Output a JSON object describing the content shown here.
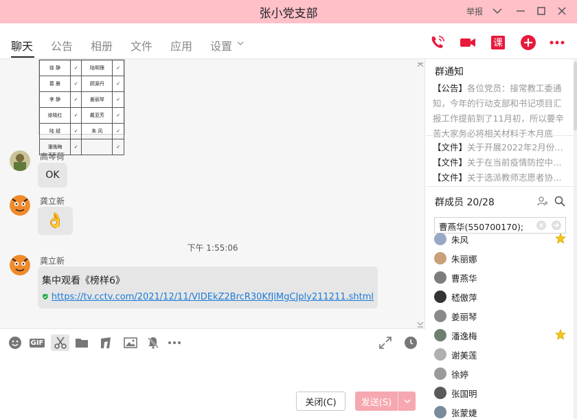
{
  "window": {
    "title": "张小党支部",
    "report_label": "举报"
  },
  "tabs": [
    "聊天",
    "公告",
    "相册",
    "文件",
    "应用",
    "设置"
  ],
  "header_actions": {
    "course_label": "课"
  },
  "table_image": {
    "rows": [
      [
        "徐 静",
        "✓",
        "陆明理",
        "✓"
      ],
      [
        "葛 晨",
        "✓",
        "顾源丹",
        "✓"
      ],
      [
        "李 静",
        "✓",
        "姜丽琴",
        "✓"
      ],
      [
        "徐晓红",
        "✓",
        "戴亚芳",
        "✓"
      ],
      [
        "陆 斌",
        "✓",
        "朱 风",
        "✓"
      ],
      [
        "潘逸梅",
        "✓",
        "",
        "✓"
      ]
    ]
  },
  "messages": [
    {
      "sender": "高琴荷",
      "text": "OK"
    },
    {
      "sender": "龚立新",
      "emoji": "👌"
    },
    {
      "time": "下午 1:55:06"
    },
    {
      "sender": "龚立新",
      "text": "集中观看《榜样6》",
      "link": "https://tv.cctv.com/2021/12/11/VIDEkZ2BrcR30KfJlMgCJply211211.shtml"
    }
  ],
  "toolbar": {
    "gif_label": "GIF"
  },
  "buttons": {
    "close": "关闭(C)",
    "send": "发送(S)"
  },
  "right_panel": {
    "notice_title": "群通知",
    "notice_tag": "【公告】",
    "notice_text": "各位党员：接常教工委通知，今年的行动支部和书记项目汇报工作提前到了11月初，所以要辛苦大家务必将相关材料于本月底（...",
    "files": [
      {
        "tag": "【文件】",
        "text": "关于开展2022年2月份主..."
      },
      {
        "tag": "【文件】",
        "text": "关于在当前疫情防控中进..."
      },
      {
        "tag": "【文件】",
        "text": "关于选派教师志愿者协助..."
      }
    ],
    "members_title": "群成员 20/28",
    "search_value": "曹燕华(550700170);",
    "members": [
      {
        "name": "朱风",
        "star": true
      },
      {
        "name": "朱丽娜",
        "star": false
      },
      {
        "name": "曹燕华",
        "star": false
      },
      {
        "name": "嵇傲萍",
        "star": false
      },
      {
        "name": "姜丽琴",
        "star": false
      },
      {
        "name": "潘逸梅",
        "star": true
      },
      {
        "name": "谢美莲",
        "star": false
      },
      {
        "name": "徐婷",
        "star": false
      },
      {
        "name": "张国明",
        "star": false
      },
      {
        "name": "张蒙婕",
        "star": false
      }
    ]
  },
  "colors": {
    "titlebar": "#ffc0c8",
    "accent": "#e8193c",
    "send": "#f6a8b0",
    "link": "#1a7ad8"
  }
}
